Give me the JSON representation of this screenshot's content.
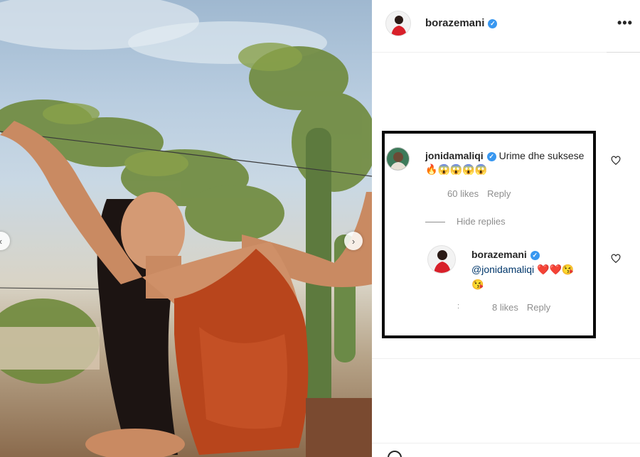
{
  "post": {
    "username": "borazemani",
    "verified_mark": "✓",
    "more_icon": "more-horizontal-icon",
    "more_label": "•••",
    "nav_prev_label": "‹",
    "nav_next_label": "›"
  },
  "comment": {
    "username": "jonidamaliqi",
    "text": "Urime dhe suksese",
    "fire": "🔥",
    "faces": "😱😱😱😱",
    "likes": "60 likes",
    "reply_label": "Reply",
    "hide_replies": "Hide replies",
    "heart_icon": "heart-outline-icon"
  },
  "reply": {
    "username": "borazemani",
    "mention": "@jonidamaliqi",
    "hearts": "❤️❤️",
    "kiss": "😘",
    "kiss2": "😘",
    "likes": "8 likes",
    "reply_label": "Reply",
    "dot": ":"
  },
  "colors": {
    "verified": "#3897f0",
    "highlight_border": "#0a0a0a",
    "mention": "#00376b",
    "muted": "#8e8e8e"
  }
}
